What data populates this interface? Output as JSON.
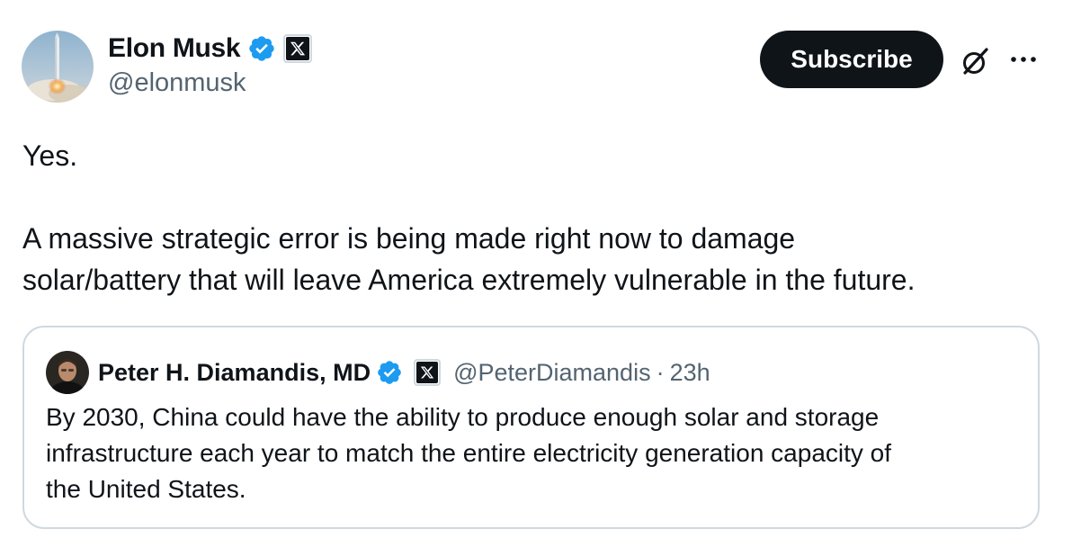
{
  "author": {
    "name": "Elon Musk",
    "handle": "@elonmusk",
    "avatar_icon": "rocket-launch-avatar",
    "verified": true,
    "affiliate_badge": "x-logo-icon"
  },
  "actions": {
    "subscribe_label": "Subscribe",
    "grok_icon": "grok-icon",
    "more_icon": "more-icon"
  },
  "tweet": {
    "line1": "Yes.",
    "line2": "A massive strategic error is being made right now to damage",
    "line3": "solar/battery that will leave America extremely vulnerable in the future."
  },
  "quote": {
    "name": "Peter H. Diamandis, MD",
    "handle": "@PeterDiamandis",
    "separator": "·",
    "time": "23h",
    "verified": true,
    "line1": "By 2030, China could have the ability to produce enough solar and storage",
    "line2": "infrastructure each year to match the entire electricity generation capacity of",
    "line3": "the United States."
  },
  "colors": {
    "text_primary": "#0f1419",
    "text_secondary": "#536471",
    "verified_blue": "#1d9bf0",
    "border": "#cfd9de",
    "button_bg": "#0f1419"
  }
}
